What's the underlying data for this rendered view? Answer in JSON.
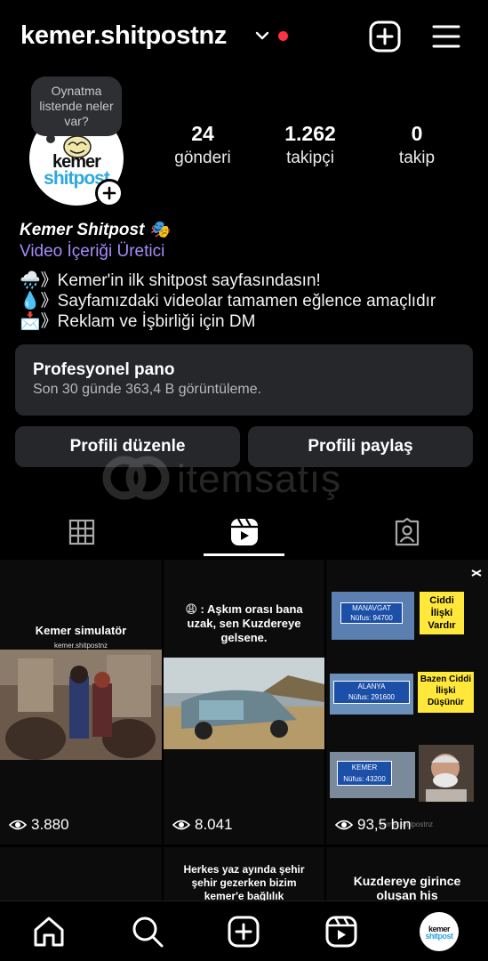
{
  "header": {
    "username": "kemer.shitpostnz",
    "icons": [
      "chevron-down-icon",
      "notification-dot",
      "add-post-icon",
      "menu-icon"
    ]
  },
  "note": {
    "text": "Oynatma listende neler var?"
  },
  "avatar": {
    "logo_top": "kemer",
    "logo_bottom": "shitpost"
  },
  "stats": [
    {
      "value": "24",
      "label": "gönderi"
    },
    {
      "value": "1.262",
      "label": "takipçi"
    },
    {
      "value": "0",
      "label": "takip"
    }
  ],
  "bio": {
    "name": "Kemer Shitpost 🎭",
    "category": "Video İçeriği Üretici",
    "lines": [
      "🌧️》Kemer'in ilk shitpost sayfasındasın!",
      "💧》Sayfamızdaki videolar tamamen eğlence amaçlıdır",
      "📩》Reklam ve İşbirliği için DM"
    ]
  },
  "dashboard": {
    "title": "Profesyonel pano",
    "subtitle": "Son 30 günde 363,4 B görüntüleme."
  },
  "buttons": {
    "edit": "Profili düzenle",
    "share": "Profili paylaş"
  },
  "watermark": {
    "text": "itemsatış"
  },
  "tabs": [
    "grid-icon",
    "reels-icon",
    "tagged-icon"
  ],
  "grid": [
    {
      "caption": "Kemer simulatör",
      "subcaption": "kemer.shitpostnz",
      "views": "3.880"
    },
    {
      "caption": "😩 : Aşkım orası bana uzak, sen Kuzdereye gelsene.",
      "views": "8.041"
    },
    {
      "views": "93,5 bin",
      "panels": [
        {
          "sign": "MANAVGAT",
          "sub": "Nüfus: 94700",
          "note": "Ciddi İlişki Vardır"
        },
        {
          "sign": "ALANYA",
          "sub": "Nüfus: 291600",
          "note": "Bazen Ciddi İlişki Düşünür"
        },
        {
          "sign": "KEMER",
          "sub": "Nüfus: 43200",
          "note": ""
        }
      ],
      "watermark": "kemer.shitpostnz"
    },
    {
      "caption": ""
    },
    {
      "caption": "Herkes yaz ayında şehir şehir gezerken bizim kemer'e bağlılık"
    },
    {
      "caption": "Kuzdereye girince oluşan his"
    }
  ],
  "nav": [
    "home-icon",
    "search-icon",
    "create-icon",
    "reels-icon",
    "profile-avatar"
  ]
}
